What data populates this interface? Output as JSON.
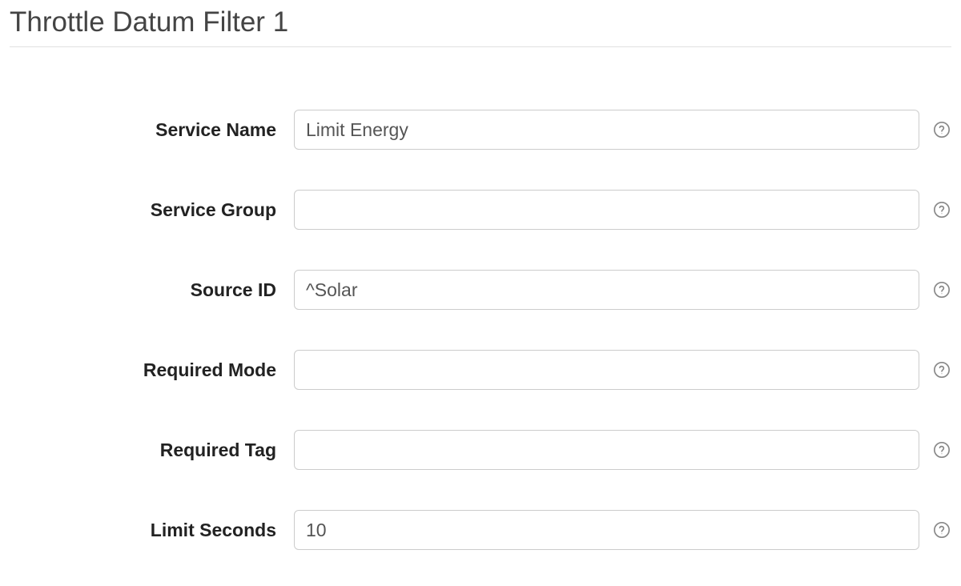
{
  "title": "Throttle Datum Filter 1",
  "fields": {
    "service_name": {
      "label": "Service Name",
      "value": "Limit Energy"
    },
    "service_group": {
      "label": "Service Group",
      "value": ""
    },
    "source_id": {
      "label": "Source ID",
      "value": "^Solar"
    },
    "required_mode": {
      "label": "Required Mode",
      "value": ""
    },
    "required_tag": {
      "label": "Required Tag",
      "value": ""
    },
    "limit_seconds": {
      "label": "Limit Seconds",
      "value": "10"
    }
  }
}
